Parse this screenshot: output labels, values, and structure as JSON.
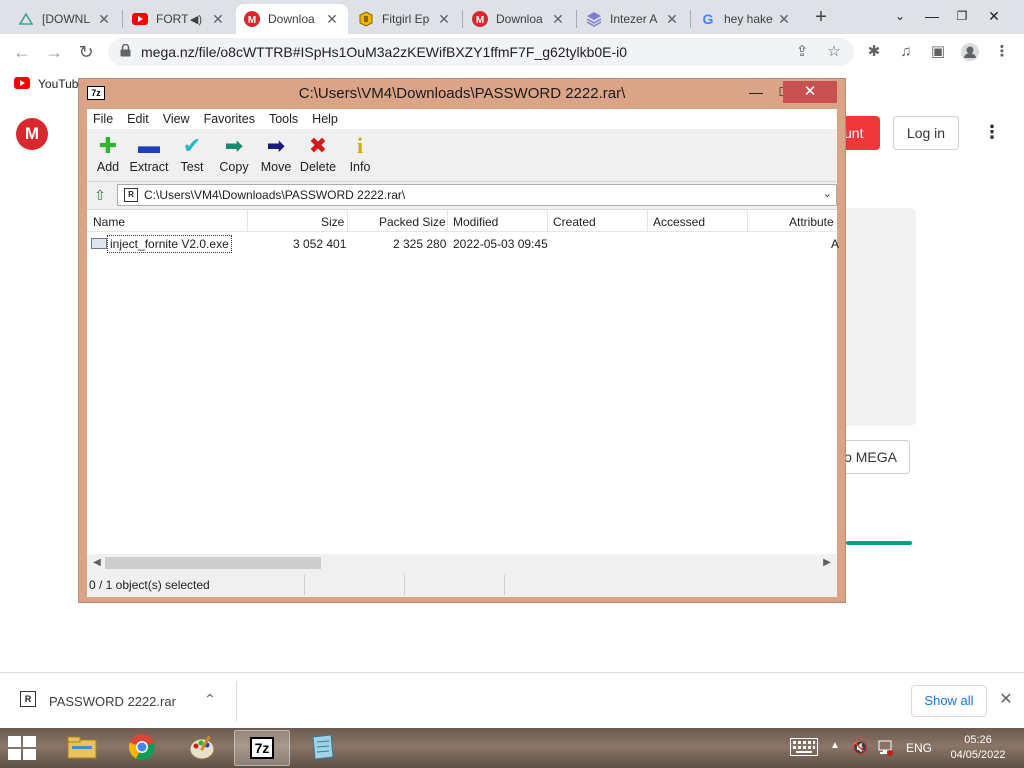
{
  "browser": {
    "tabs": [
      {
        "title": "[DOWNL",
        "icon": "triangle-icon",
        "active": false
      },
      {
        "title": "FORT",
        "icon": "youtube-icon",
        "active": false,
        "audio": true
      },
      {
        "title": "Downloa",
        "icon": "mega-icon",
        "active": true
      },
      {
        "title": "Fitgirl Ep",
        "icon": "fitgirl-icon",
        "active": false
      },
      {
        "title": "Downloa",
        "icon": "mega-icon",
        "active": false
      },
      {
        "title": "Intezer A",
        "icon": "intezer-icon",
        "active": false
      },
      {
        "title": "hey hake",
        "icon": "google-icon",
        "active": false
      }
    ],
    "tab_close_glyph": "✕",
    "new_tab_glyph": "+",
    "url": "mega.nz/file/o8cWTTRB#ISpHs1OuM3a2zKEWifBXZY1ffmF7F_g62tylkb0E-i0",
    "bookmark": "YouTube"
  },
  "mega": {
    "logo_letter": "M",
    "create_account_fragment": "unt",
    "login_label": "Log in",
    "download_fragment": "o MEGA"
  },
  "sevenzip": {
    "app_icon_text": "7z",
    "title": "C:\\Users\\VM4\\Downloads\\PASSWORD 2222.rar\\",
    "menu": [
      "File",
      "Edit",
      "View",
      "Favorites",
      "Tools",
      "Help"
    ],
    "toolbar": [
      {
        "label": "Add",
        "icon": "add-icon",
        "glyph": "✚",
        "color": "#2fb52f"
      },
      {
        "label": "Extract",
        "icon": "extract-icon",
        "glyph": "▬",
        "color": "#1f3fbf"
      },
      {
        "label": "Test",
        "icon": "test-icon",
        "glyph": "✔",
        "color": "#1fb8c8"
      },
      {
        "label": "Copy",
        "icon": "copy-icon",
        "glyph": "➡",
        "color": "#1a8a6e"
      },
      {
        "label": "Move",
        "icon": "move-icon",
        "glyph": "➡",
        "color": "#1a1a7a"
      },
      {
        "label": "Delete",
        "icon": "delete-icon",
        "glyph": "✖",
        "color": "#d11a1a"
      },
      {
        "label": "Info",
        "icon": "info-icon",
        "glyph": "i",
        "color": "#c9b000"
      }
    ],
    "path": "C:\\Users\\VM4\\Downloads\\PASSWORD 2222.rar\\",
    "path_icon_text": "R",
    "columns": [
      "Name",
      "Size",
      "Packed Size",
      "Modified",
      "Created",
      "Accessed",
      "Attribute"
    ],
    "files": [
      {
        "name": "inject_fornite V2.0.exe",
        "size": "3 052 401",
        "packed_size": "2 325 280",
        "modified": "2022-05-03 09:45",
        "created": "",
        "accessed": "",
        "attributes": "A"
      }
    ],
    "status": "0 / 1 object(s) selected"
  },
  "download_shelf": {
    "file_name": "PASSWORD 2222.rar",
    "file_icon_text": "R",
    "show_all_label": "Show all"
  },
  "taskbar": {
    "apps": [
      {
        "name": "file-explorer-icon",
        "active": false
      },
      {
        "name": "chrome-icon",
        "active": false
      },
      {
        "name": "paint-icon",
        "active": false
      },
      {
        "name": "sevenzip-icon",
        "label": "7z",
        "active": true
      },
      {
        "name": "notepad-icon",
        "active": false
      }
    ],
    "language": "ENG",
    "time": "05:26",
    "date": "04/05/2022"
  }
}
